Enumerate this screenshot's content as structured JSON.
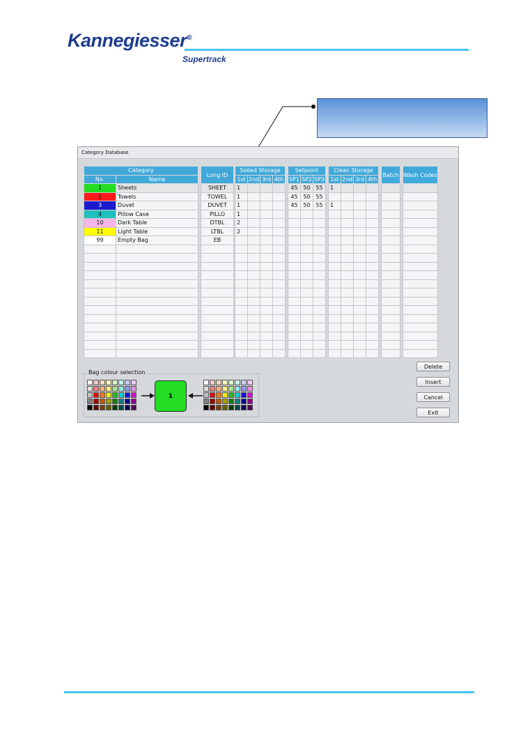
{
  "brand": {
    "logo": "Kannegiesser",
    "product": "Supertrack"
  },
  "window": {
    "title": "Category Database"
  },
  "table": {
    "group_headers": [
      "Category",
      "Long ID",
      "Soiled Storage",
      "Setpoint",
      "Clean Storage",
      "Batch",
      "Wash Codes"
    ],
    "sub_headers": {
      "category": [
        "No.",
        "Name"
      ],
      "soiled": [
        "1st",
        "2nd",
        "3rd",
        "4th"
      ],
      "setpoint": [
        "SP1",
        "SP2",
        "SP3"
      ],
      "clean": [
        "1st",
        "2nd",
        "3rd",
        "4th"
      ]
    },
    "rows": [
      {
        "no": "1",
        "color": "#22dd22",
        "name": "Sheets",
        "long_id": "SHEET",
        "soiled": [
          "1",
          "",
          "",
          ""
        ],
        "sp": [
          "45",
          "50",
          "55"
        ],
        "clean": [
          "1",
          "",
          "",
          ""
        ],
        "batch": "",
        "wash": ""
      },
      {
        "no": "2",
        "color": "#ff1a1a",
        "name": "Towels",
        "long_id": "TOWEL",
        "soiled": [
          "1",
          "",
          "",
          ""
        ],
        "sp": [
          "45",
          "50",
          "55"
        ],
        "clean": [
          "",
          "",
          "",
          ""
        ],
        "batch": "",
        "wash": ""
      },
      {
        "no": "3",
        "color": "#1a1acc",
        "name": "Duvet",
        "long_id": "DUVET",
        "soiled": [
          "1",
          "",
          "",
          ""
        ],
        "sp": [
          "45",
          "50",
          "55"
        ],
        "clean": [
          "1",
          "",
          "",
          ""
        ],
        "batch": "",
        "wash": ""
      },
      {
        "no": "4",
        "color": "#1fbfbf",
        "name": "Pillow Case",
        "long_id": "PILLO",
        "soiled": [
          "1",
          "",
          "",
          ""
        ],
        "sp": [
          "",
          "",
          ""
        ],
        "clean": [
          "",
          "",
          "",
          ""
        ],
        "batch": "",
        "wash": ""
      },
      {
        "no": "10",
        "color": "#f7b4e6",
        "name": "Dark Table",
        "long_id": "DTBL",
        "soiled": [
          "2",
          "",
          "",
          ""
        ],
        "sp": [
          "",
          "",
          ""
        ],
        "clean": [
          "",
          "",
          "",
          ""
        ],
        "batch": "",
        "wash": ""
      },
      {
        "no": "11",
        "color": "#ffff00",
        "name": "Light Table",
        "long_id": "LTBL",
        "soiled": [
          "2",
          "",
          "",
          ""
        ],
        "sp": [
          "",
          "",
          ""
        ],
        "clean": [
          "",
          "",
          "",
          ""
        ],
        "batch": "",
        "wash": ""
      },
      {
        "no": "99",
        "color": "#ffffff",
        "name": "Empty Bag",
        "long_id": "EB",
        "soiled": [
          "",
          "",
          "",
          ""
        ],
        "sp": [
          "",
          "",
          ""
        ],
        "clean": [
          "",
          "",
          "",
          ""
        ],
        "batch": "",
        "wash": ""
      }
    ],
    "empty_rows": 13
  },
  "bag_colour": {
    "label": "Bag colour selection",
    "selected_value": "1",
    "selected_color": "#22dd22",
    "palette": [
      "#ffffff",
      "#f4c8c8",
      "#f8dcc0",
      "#fff6c0",
      "#d8f4c8",
      "#c8f4f4",
      "#c8d0f8",
      "#f4c8f4",
      "#e0e0e0",
      "#f08080",
      "#f4b080",
      "#fff080",
      "#a8e890",
      "#90e8e8",
      "#9098f0",
      "#e890e8",
      "#c0c0c0",
      "#e01010",
      "#f07818",
      "#f0f010",
      "#20c020",
      "#10d0d0",
      "#1010e0",
      "#d010d0",
      "#808080",
      "#a00000",
      "#c05800",
      "#a0a000",
      "#108010",
      "#108080",
      "#000090",
      "#900090",
      "#000000",
      "#600000",
      "#704000",
      "#606000",
      "#004000",
      "#004848",
      "#000050",
      "#500050"
    ]
  },
  "buttons": {
    "delete": "Delete",
    "insert": "Insert",
    "cancel": "Cancel",
    "exit": "Exit"
  }
}
